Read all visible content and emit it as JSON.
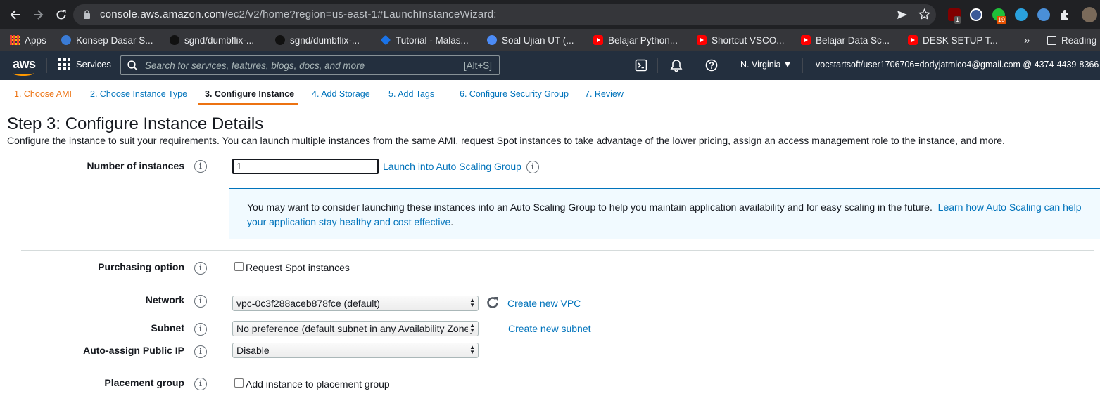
{
  "browser": {
    "url_host": "console.aws.amazon.com",
    "url_path": "/ec2/v2/home?region=us-east-1#LaunchInstanceWizard:",
    "ext_badge_1": "1",
    "ext_badge_2": "19",
    "reading_list_label": "Reading"
  },
  "bookmarks": [
    {
      "label": "Apps"
    },
    {
      "label": "Konsep Dasar S..."
    },
    {
      "label": "sgnd/dumbflix-..."
    },
    {
      "label": "sgnd/dumbflix-..."
    },
    {
      "label": "Tutorial - Malas..."
    },
    {
      "label": "Soal Ujian UT (..."
    },
    {
      "label": "Belajar Python..."
    },
    {
      "label": "Shortcut VSCO..."
    },
    {
      "label": "Belajar Data Sc..."
    },
    {
      "label": "DESK SETUP T..."
    }
  ],
  "aws": {
    "logo": "aws",
    "services_label": "Services",
    "search_placeholder": "Search for services, features, blogs, docs, and more",
    "search_shortcut": "[Alt+S]",
    "region": "N. Virginia",
    "account": "vocstartsoft/user1706706=dodyjatmico4@gmail.com @ 4374-4439-8366"
  },
  "wizard": {
    "tabs": [
      {
        "label": "1. Choose AMI"
      },
      {
        "label": "2. Choose Instance Type"
      },
      {
        "label": "3. Configure Instance"
      },
      {
        "label": "4. Add Storage"
      },
      {
        "label": "5. Add Tags"
      },
      {
        "label": "6. Configure Security Group"
      },
      {
        "label": "7. Review"
      }
    ],
    "title": "Step 3: Configure Instance Details",
    "description": "Configure the instance to suit your requirements. You can launch multiple instances from the same AMI, request Spot instances to take advantage of the lower pricing, assign an access management role to the instance, and more."
  },
  "form": {
    "num_instances_label": "Number of instances",
    "num_instances_value": "1",
    "asg_link": "Launch into Auto Scaling Group",
    "callout_text": "You may want to consider launching these instances into an Auto Scaling Group to help you maintain application availability and for easy scaling in the future.",
    "callout_link": "Learn how Auto Scaling can help your application stay healthy and cost effective",
    "callout_period": ".",
    "purchasing_label": "Purchasing option",
    "spot_label": "Request Spot instances",
    "network_label": "Network",
    "network_value": "vpc-0c3f288aceb878fce (default)",
    "create_vpc": "Create new VPC",
    "subnet_label": "Subnet",
    "subnet_value": "No preference (default subnet in any Availability Zone)",
    "create_subnet": "Create new subnet",
    "public_ip_label": "Auto-assign Public IP",
    "public_ip_value": "Disable",
    "placement_label": "Placement group",
    "placement_checkbox": "Add instance to placement group",
    "info_glyph": "i"
  }
}
